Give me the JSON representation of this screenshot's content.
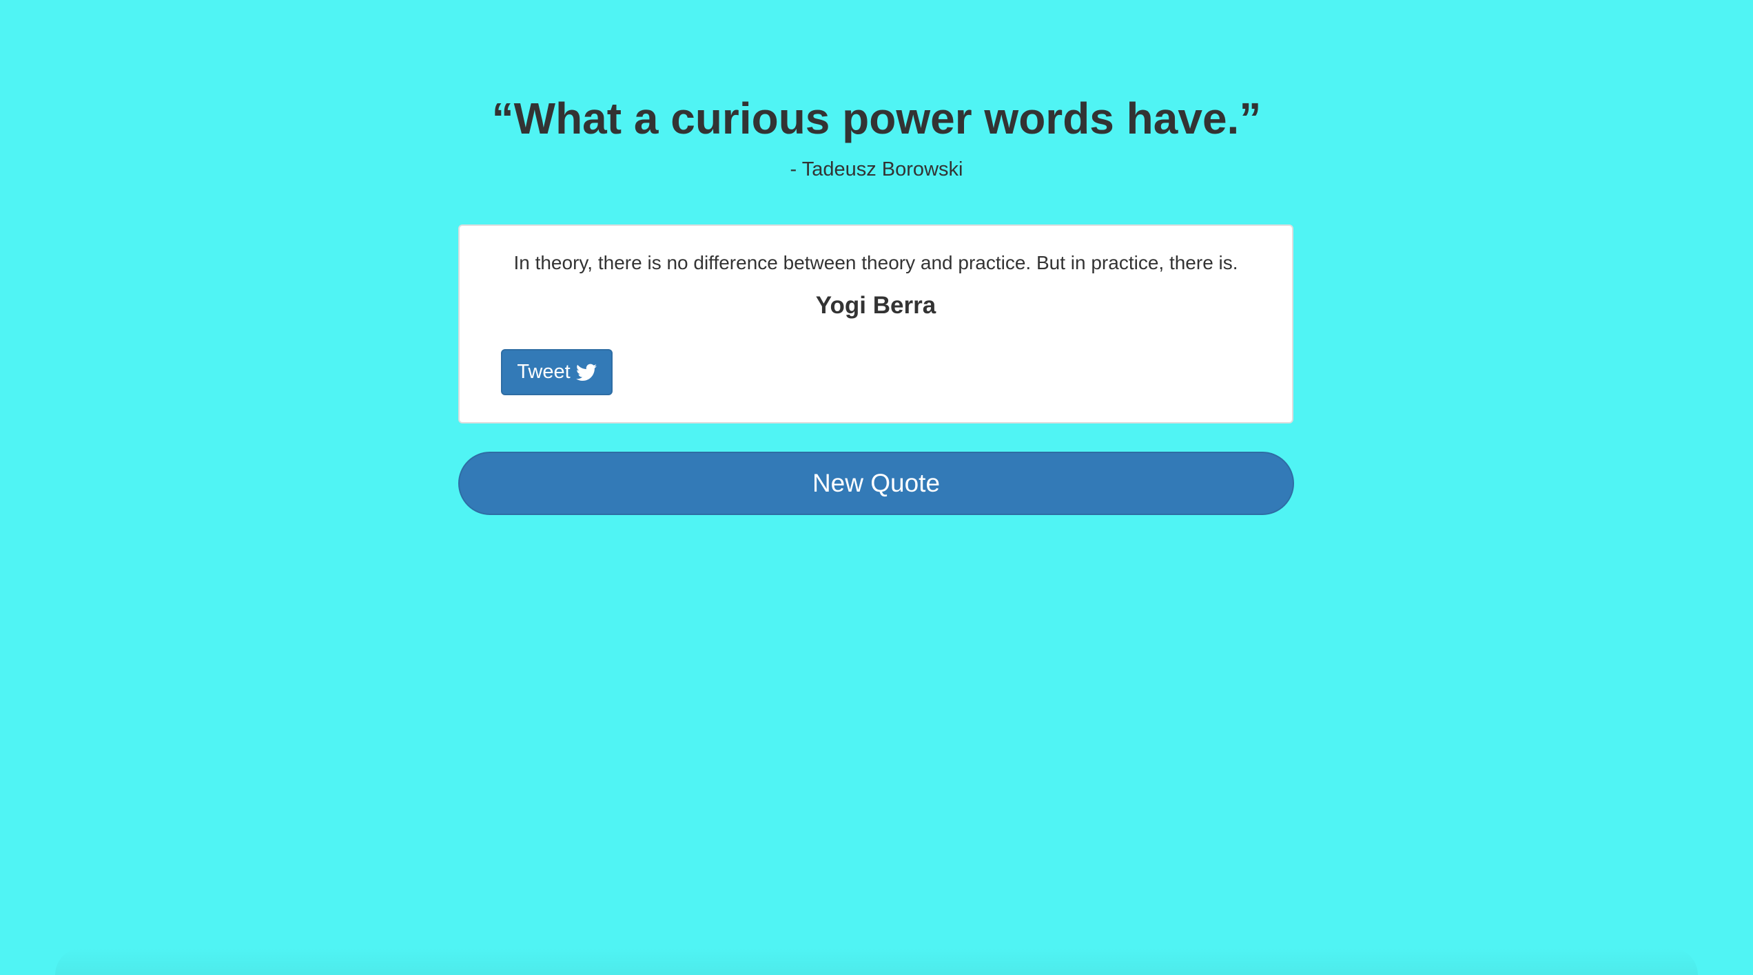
{
  "header": {
    "quote": "“What a curious power words have.”",
    "author": "- Tadeusz Borowski"
  },
  "quote_card": {
    "text": "In theory, there is no difference between theory and practice. But in practice, there is.",
    "author": "Yogi Berra",
    "tweet_label": "Tweet",
    "tweet_icon": "twitter-bird-icon"
  },
  "new_quote_label": "New Quote",
  "colors": {
    "background": "#50f4f4",
    "button": "#337ab7",
    "text": "#333333"
  }
}
